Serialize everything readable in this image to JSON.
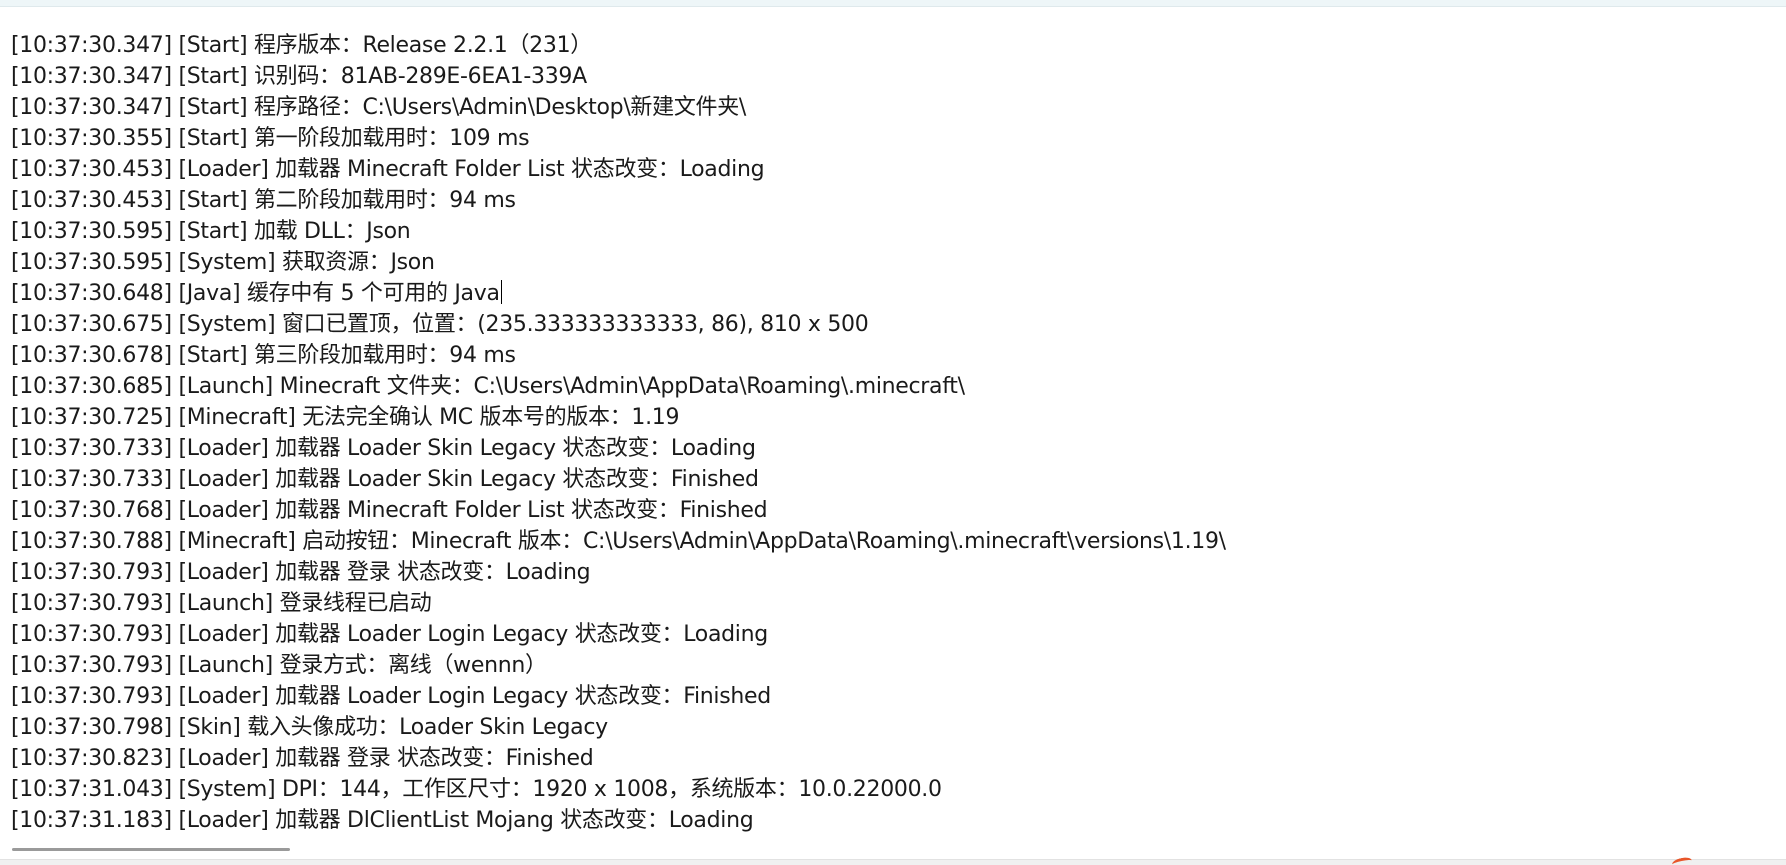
{
  "log": {
    "lines": [
      "[10:37:30.347] [Start] 程序版本：Release 2.2.1（231）",
      "[10:37:30.347] [Start] 识别码：81AB-289E-6EA1-339A",
      "[10:37:30.347] [Start] 程序路径：C:\\Users\\Admin\\Desktop\\新建文件夹\\",
      "[10:37:30.355] [Start] 第一阶段加载用时：109 ms",
      "[10:37:30.453] [Loader] 加载器 Minecraft Folder List 状态改变：Loading",
      "[10:37:30.453] [Start] 第二阶段加载用时：94 ms",
      "[10:37:30.595] [Start] 加载 DLL：Json",
      "[10:37:30.595] [System] 获取资源：Json",
      "[10:37:30.648] [Java] 缓存中有 5 个可用的 Java",
      "[10:37:30.675] [System] 窗口已置顶，位置：(235.333333333333, 86), 810 x 500",
      "[10:37:30.678] [Start] 第三阶段加载用时：94 ms",
      "[10:37:30.685] [Launch] Minecraft 文件夹：C:\\Users\\Admin\\AppData\\Roaming\\.minecraft\\",
      "[10:37:30.725] [Minecraft] 无法完全确认 MC 版本号的版本：1.19",
      "[10:37:30.733] [Loader] 加载器 Loader Skin Legacy 状态改变：Loading",
      "[10:37:30.733] [Loader] 加载器 Loader Skin Legacy 状态改变：Finished",
      "[10:37:30.768] [Loader] 加载器 Minecraft Folder List 状态改变：Finished",
      "[10:37:30.788] [Minecraft] 启动按钮：Minecraft 版本：C:\\Users\\Admin\\AppData\\Roaming\\.minecraft\\versions\\1.19\\",
      "[10:37:30.793] [Loader] 加载器 登录 状态改变：Loading",
      "[10:37:30.793] [Launch] 登录线程已启动",
      "[10:37:30.793] [Loader] 加载器 Loader Login Legacy 状态改变：Loading",
      "[10:37:30.793] [Launch] 登录方式：离线（wennn）",
      "[10:37:30.793] [Loader] 加载器 Loader Login Legacy 状态改变：Finished",
      "[10:37:30.798] [Skin] 载入头像成功：Loader Skin Legacy",
      "[10:37:30.823] [Loader] 加载器 登录 状态改变：Finished",
      "[10:37:31.043] [System] DPI：144，工作区尺寸：1920 x 1008，系统版本：10.0.22000.0",
      "[10:37:31.183] [Loader] 加载器 DlClientList Mojang 状态改变：Loading"
    ],
    "caret_line_index": 8
  },
  "scrollbar": {
    "horizontal_position": 0
  }
}
